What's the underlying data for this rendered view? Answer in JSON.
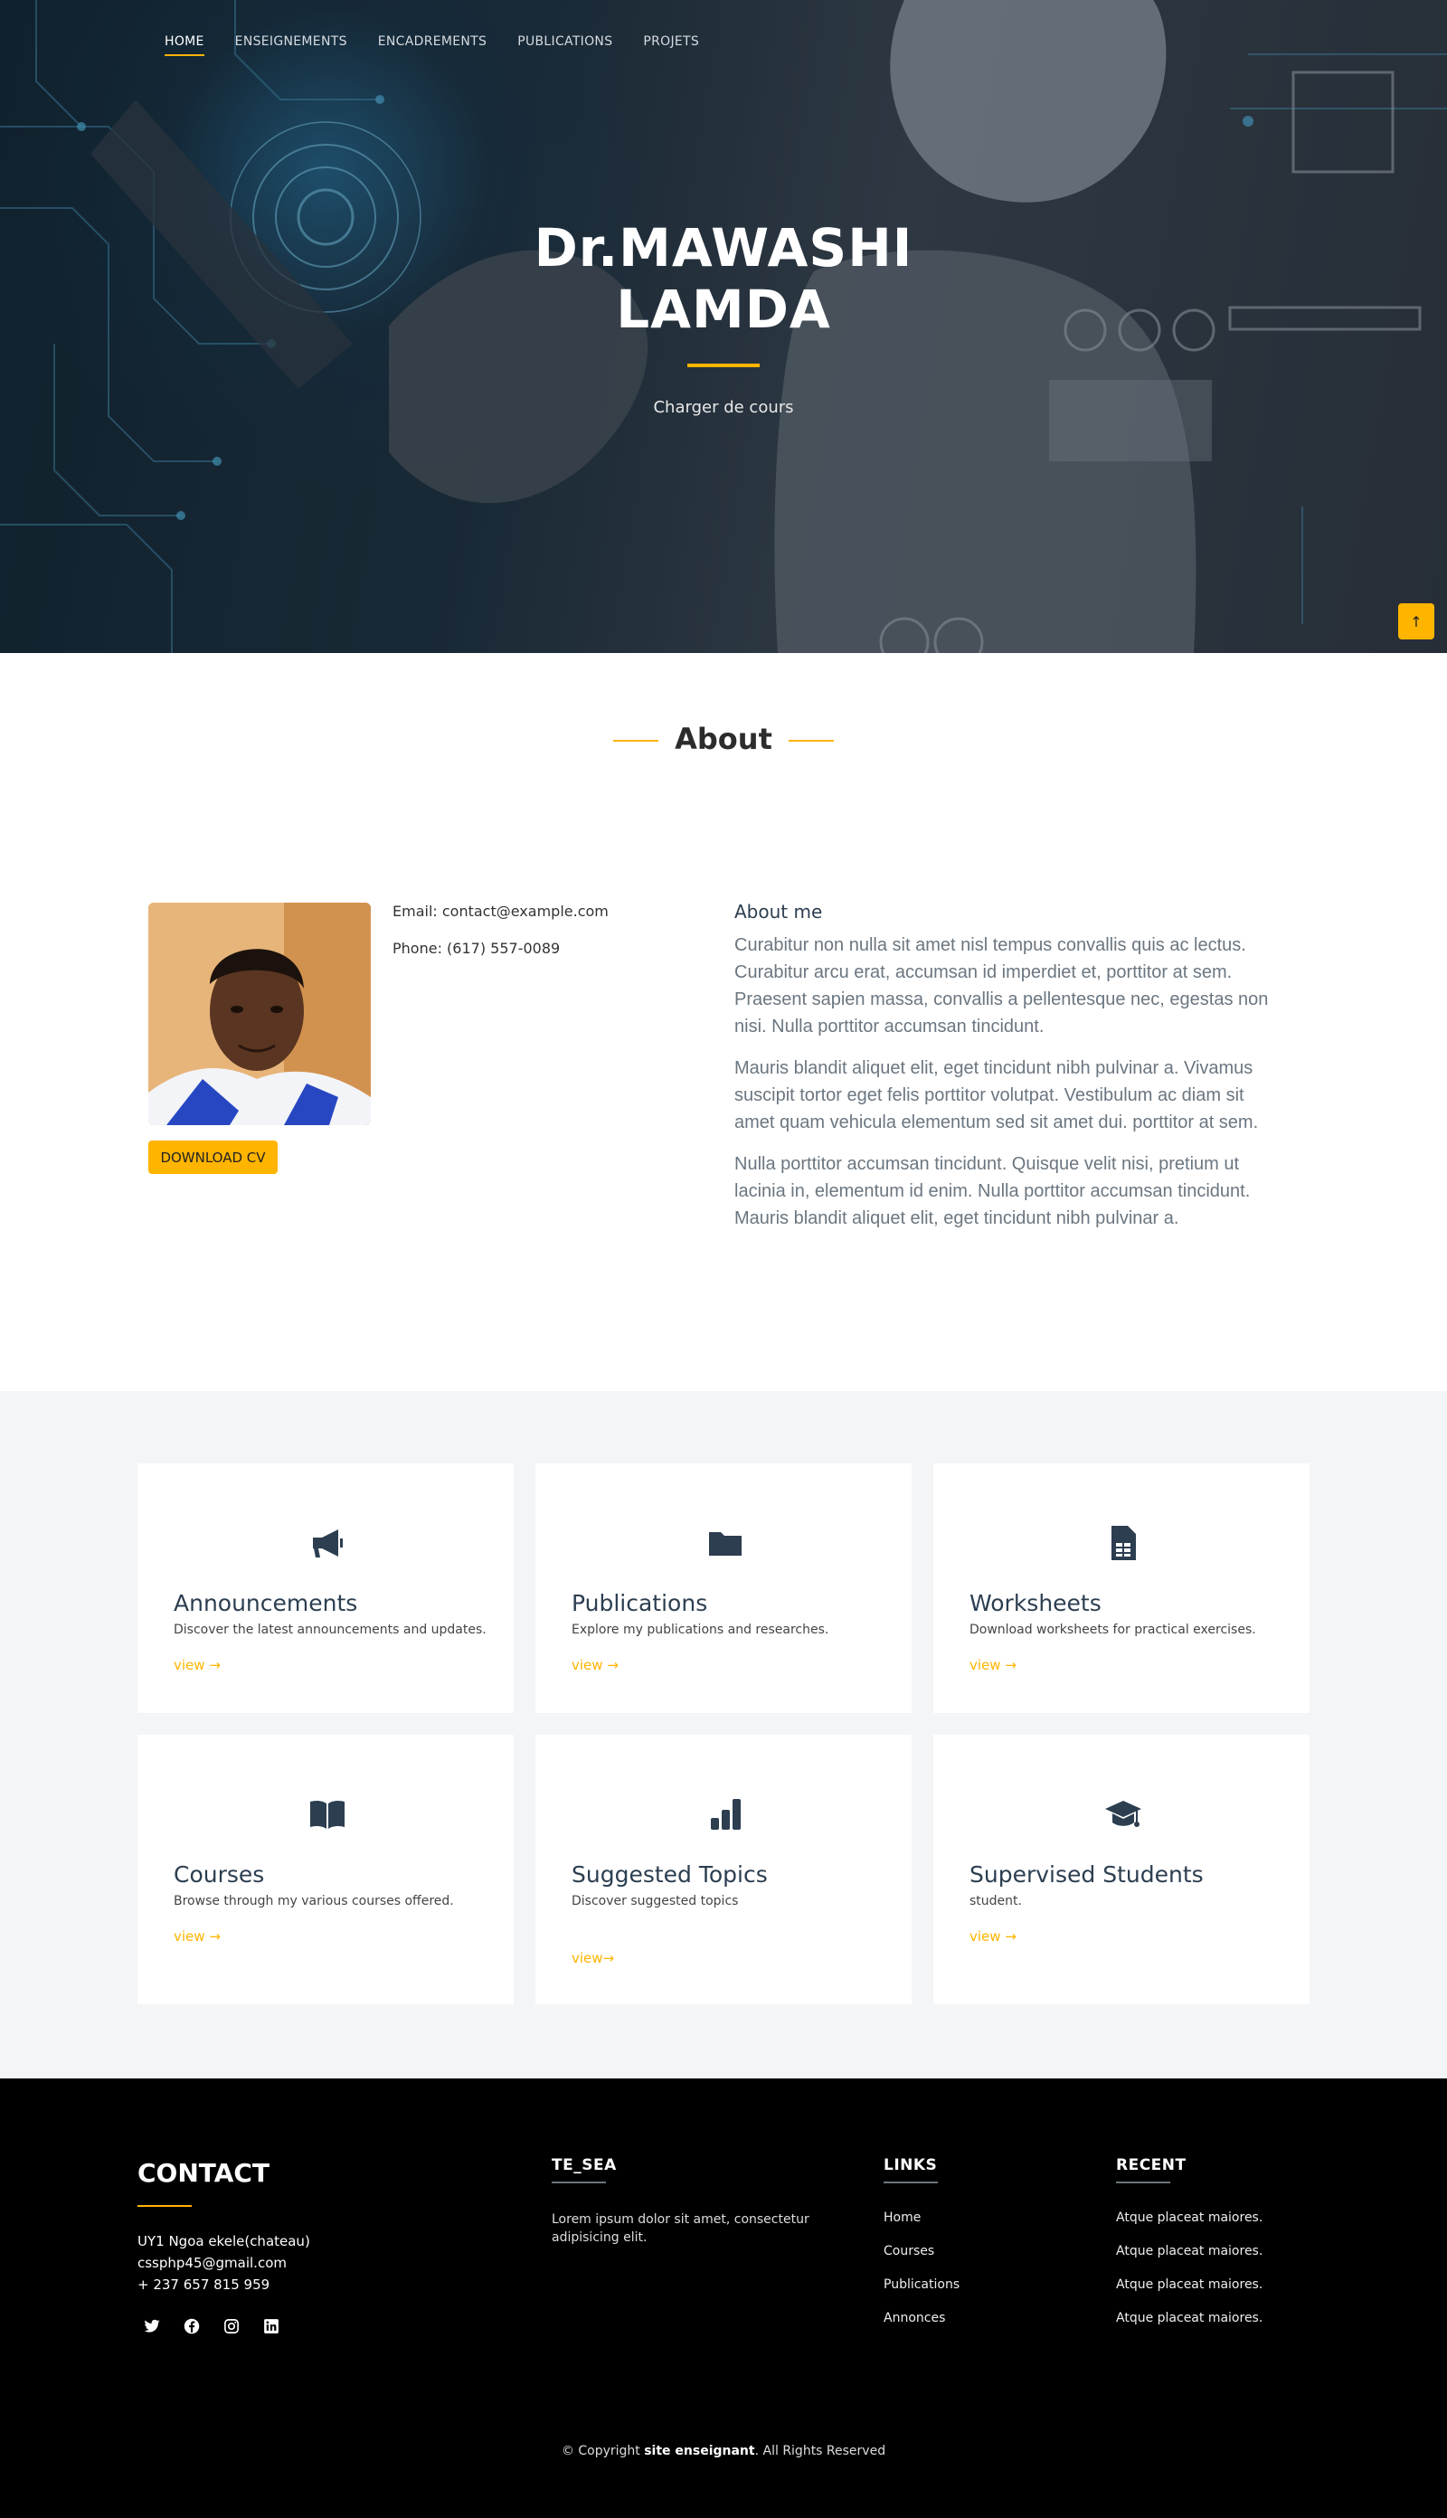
{
  "nav": {
    "items": [
      "HOME",
      "ENSEIGNEMENTS",
      "ENCADREMENTS",
      "PUBLICATIONS",
      "PROJETS"
    ],
    "active": "HOME"
  },
  "hero": {
    "title_line1": "Dr.MAWASHI",
    "title_line2": "LAMDA",
    "subtitle": "Charger de cours"
  },
  "about": {
    "section_title": "About",
    "email": "Email: contact@example.com",
    "phone": "Phone: (617) 557-0089",
    "download_button": "DOWNLOAD CV",
    "heading": "About me",
    "paragraphs": [
      "Curabitur non nulla sit amet nisl tempus convallis quis ac lectus. Curabitur arcu erat, accumsan id imperdiet et, porttitor at sem. Praesent sapien massa, convallis a pellentesque nec, egestas non nisi. Nulla porttitor accumsan tincidunt.",
      "Mauris blandit aliquet elit, eget tincidunt nibh pulvinar a. Vivamus suscipit tortor eget felis porttitor volutpat. Vestibulum ac diam sit amet quam vehicula elementum sed sit amet dui. porttitor at sem.",
      "Nulla porttitor accumsan tincidunt. Quisque velit nisi, pretium ut lacinia in, elementum id enim. Nulla porttitor accumsan tincidunt. Mauris blandit aliquet elit, eget tincidunt nibh pulvinar a."
    ]
  },
  "cards": [
    {
      "icon": "megaphone-icon",
      "title": "Announcements",
      "desc": "Discover the latest announcements and updates.",
      "link": "view"
    },
    {
      "icon": "folder-icon",
      "title": "Publications",
      "desc": "Explore my publications and researches.",
      "link": "view"
    },
    {
      "icon": "spreadsheet-icon",
      "title": "Worksheets",
      "desc": "Download worksheets for practical exercises.",
      "link": "view"
    },
    {
      "icon": "book-icon",
      "title": "Courses",
      "desc": "Browse through my various courses offered.",
      "link": "view"
    },
    {
      "icon": "bar-chart-icon",
      "title": "Suggested Topics",
      "desc": "Discover suggested topics",
      "link": "view"
    },
    {
      "icon": "graduation-cap-icon",
      "title": "Supervised Students",
      "desc": "student.",
      "link": "view"
    }
  ],
  "footer": {
    "contact_title": "CONTACT",
    "address": "UY1 Ngoa ekele(chateau)",
    "email": "cssphp45@gmail.com",
    "phone": "+ 237 657 815 959",
    "socials": [
      "twitter-icon",
      "facebook-icon",
      "instagram-icon",
      "linkedin-icon"
    ],
    "te_sea_title": "TE_SEA",
    "te_sea_text": "Lorem ipsum dolor sit amet, consectetur adipisicing elit.",
    "links_title": "LINKS",
    "links": [
      "Home",
      "Courses",
      "Publications",
      "Annonces"
    ],
    "recent_title": "RECENT",
    "recent": [
      "Atque placeat maiores.",
      "Atque placeat maiores.",
      "Atque placeat maiores.",
      "Atque placeat maiores."
    ],
    "copyright_prefix": "© Copyright ",
    "copyright_site": "site enseignant",
    "copyright_suffix": ". All Rights Reserved"
  },
  "colors": {
    "accent": "#ffb400",
    "heading": "#2c3e50",
    "footer_bg": "#000000",
    "services_bg": "#f3f5f7"
  }
}
